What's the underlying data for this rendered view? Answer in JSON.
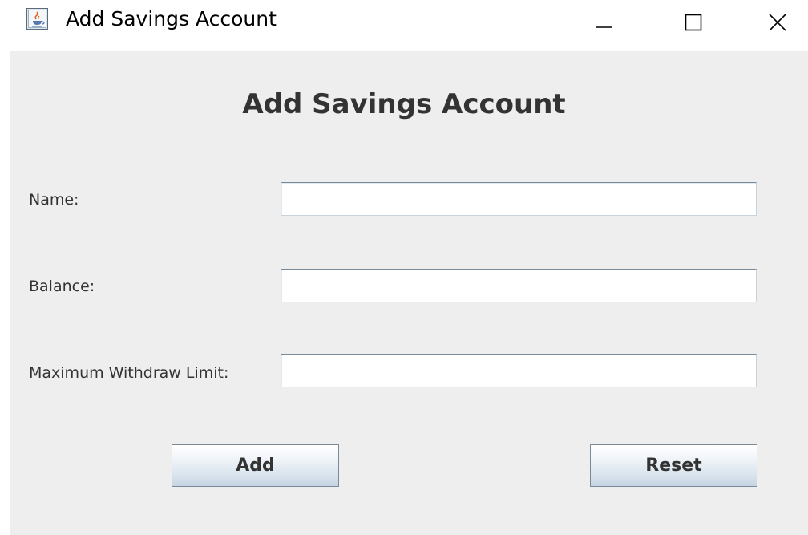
{
  "window": {
    "title": "Add Savings Account",
    "app_icon": "java-cup-icon",
    "controls": {
      "minimize": "minimize-icon",
      "maximize": "maximize-icon",
      "close": "close-icon"
    }
  },
  "form": {
    "heading": "Add Savings Account",
    "fields": [
      {
        "label": "Name:",
        "value": ""
      },
      {
        "label": "Balance:",
        "value": ""
      },
      {
        "label": "Maximum Withdraw Limit:",
        "value": ""
      }
    ],
    "buttons": {
      "add": "Add",
      "reset": "Reset"
    }
  },
  "colors": {
    "panel_background": "#eeeeee",
    "text": "#333333",
    "field_border": "#7a8a99",
    "button_gradient_bottom": "#c6d5e2"
  }
}
